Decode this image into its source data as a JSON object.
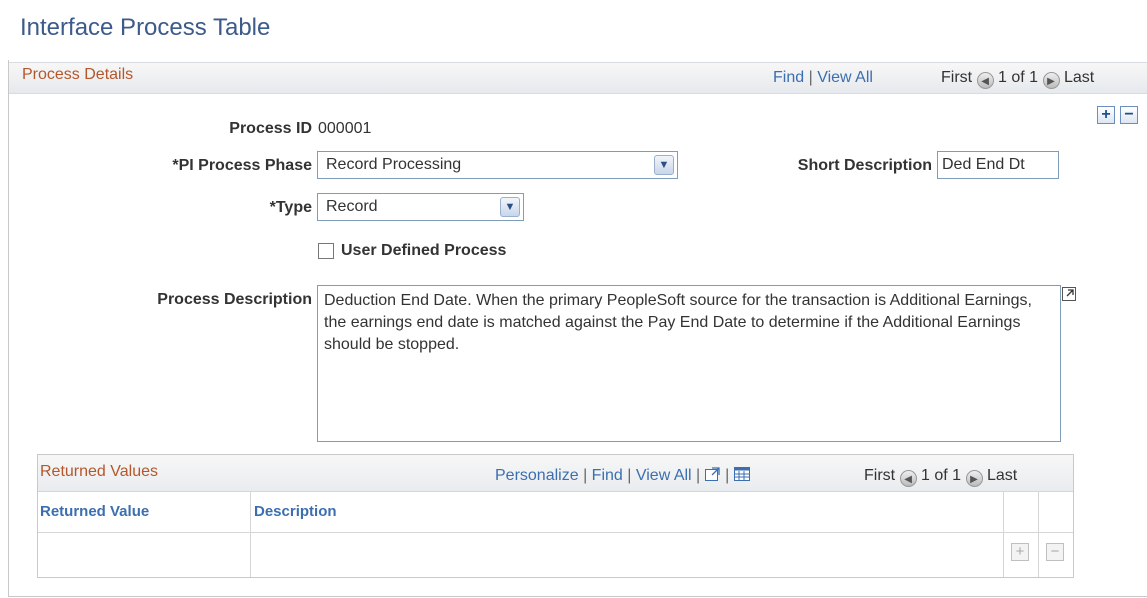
{
  "page": {
    "title": "Interface Process Table"
  },
  "section": {
    "title": "Process Details",
    "nav": {
      "find": "Find",
      "view_all": "View All",
      "first": "First",
      "count": "1 of 1",
      "last": "Last"
    }
  },
  "fields": {
    "process_id": {
      "label": "Process ID",
      "value": "000001"
    },
    "phase": {
      "label": "*PI Process Phase",
      "value": "Record Processing"
    },
    "short_desc": {
      "label": "Short Description",
      "value": "Ded End Dt"
    },
    "type": {
      "label": "*Type",
      "value": "Record"
    },
    "user_defined": {
      "label": "User Defined Process",
      "checked": false
    },
    "process_desc": {
      "label": "Process Description",
      "value": "Deduction End Date.  When the primary PeopleSoft source for the transaction is Additional Earnings, the earnings end date is matched against the Pay End Date to determine if the Additional Earnings should be stopped."
    }
  },
  "returned_values": {
    "title": "Returned Values",
    "nav": {
      "personalize": "Personalize",
      "find": "Find",
      "view_all": "View All",
      "first": "First",
      "count": "1 of 1",
      "last": "Last"
    },
    "columns": [
      "Returned Value",
      "Description"
    ]
  },
  "icons": {
    "add": "plus-icon",
    "remove": "minus-icon",
    "prev": "left-arrow-icon",
    "next": "right-arrow-icon",
    "dropdown": "chevron-down-icon",
    "expand": "expand-icon",
    "zoom": "zoom-icon",
    "download": "grid-download-icon"
  },
  "colors": {
    "title": "#3c5a8a",
    "section_title": "#b5572b",
    "link": "#3c6fb0"
  }
}
